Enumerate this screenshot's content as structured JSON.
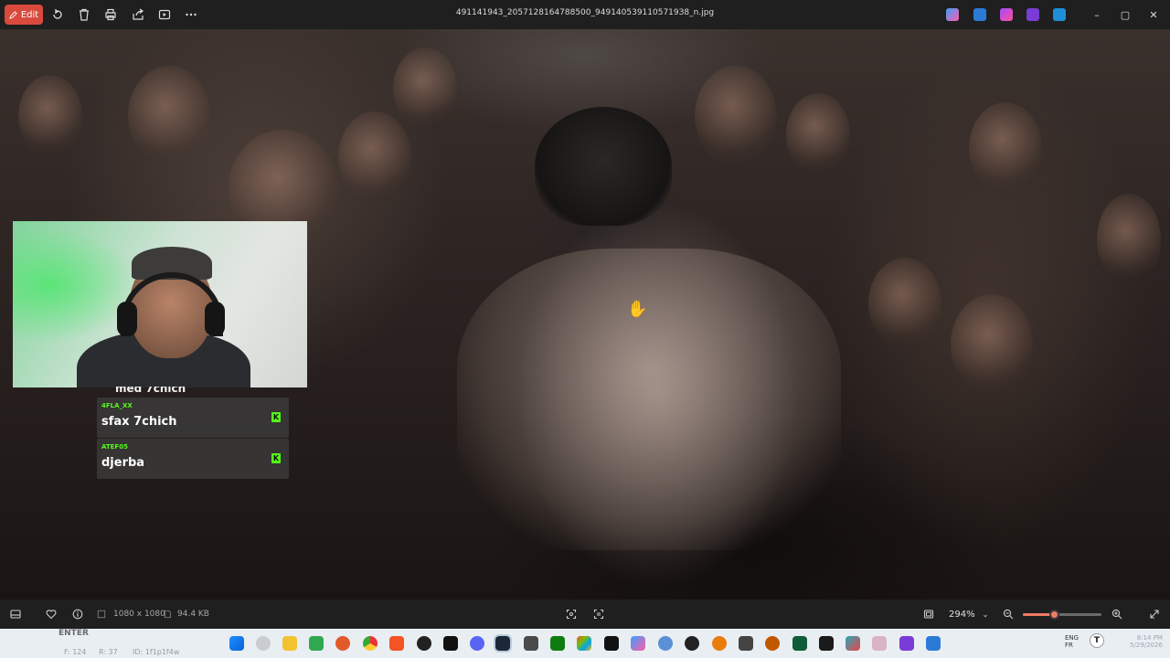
{
  "titlebar": {
    "edit_label": "Edit",
    "filename": "491141943_2057128164788500_9491405391105719З8_n.jpg"
  },
  "chat": {
    "partial_top": "med 7chich",
    "messages": [
      {
        "user": "4FLA_XX",
        "text": "sfax 7chich",
        "badge": "K"
      },
      {
        "user": "ATEF05",
        "text": "djerba",
        "badge": "K"
      }
    ]
  },
  "statusbar": {
    "dimensions": "1080 x 1080",
    "filesize": "94.4 KB",
    "zoom": "294%",
    "zoom_slider_fraction": 0.4
  },
  "taskbar": {
    "enter_label": "ENTER",
    "pos_f": "F: 124",
    "pos_r": "R: 37",
    "pos_id": "ID: 1f1p1f4w",
    "lang_1": "ENG",
    "lang_2": "FR",
    "time": "8:14 PM",
    "date": "5/29/2026",
    "avatar_letter": "T"
  },
  "colors": {
    "accent": "#d94a3d",
    "kick_green": "#53fc18",
    "slider": "#f07a62"
  },
  "icons": {
    "titlebar": [
      "edit-icon",
      "rotate-icon",
      "delete-icon",
      "print-icon",
      "share-icon",
      "slideshow-icon",
      "more-icon"
    ],
    "window_controls": [
      "minimize-icon",
      "maximize-icon",
      "close-icon"
    ],
    "statusbar": [
      "filmstrip-icon",
      "favorite-icon",
      "info-icon",
      "fit-icon",
      "select-icon",
      "fullscreen-icon",
      "zoom-out-icon",
      "zoom-in-icon",
      "expand-icon"
    ]
  }
}
